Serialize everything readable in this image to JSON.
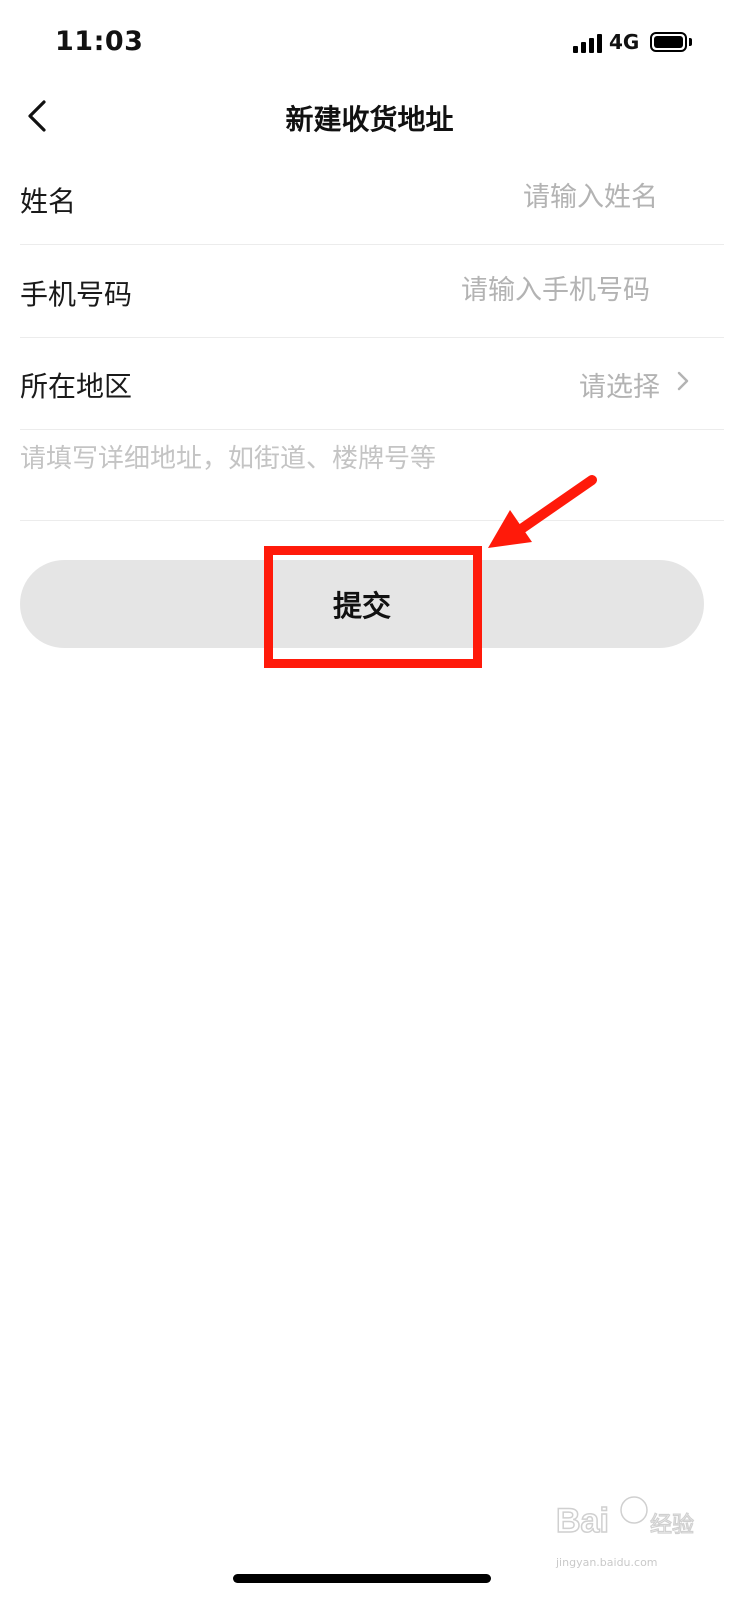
{
  "status_bar": {
    "time": "11:03",
    "network": "4G",
    "icons": [
      "signal-icon",
      "battery-icon"
    ]
  },
  "nav": {
    "title": "新建收货地址",
    "back_icon": "chevron-left-icon"
  },
  "form": {
    "name": {
      "label": "姓名",
      "placeholder": "请输入姓名",
      "value": ""
    },
    "phone": {
      "label": "手机号码",
      "placeholder": "请输入手机号码",
      "value": ""
    },
    "region": {
      "label": "所在地区",
      "value": "请选择",
      "icon": "chevron-right-icon"
    },
    "detail": {
      "placeholder": "请填写详细地址，如街道、楼牌号等",
      "value": ""
    }
  },
  "submit_label": "提交",
  "annotation": {
    "color": "#ff1a0a"
  },
  "watermark": {
    "brand": "Bai du 经验",
    "url": "jingyan.baidu.com"
  }
}
